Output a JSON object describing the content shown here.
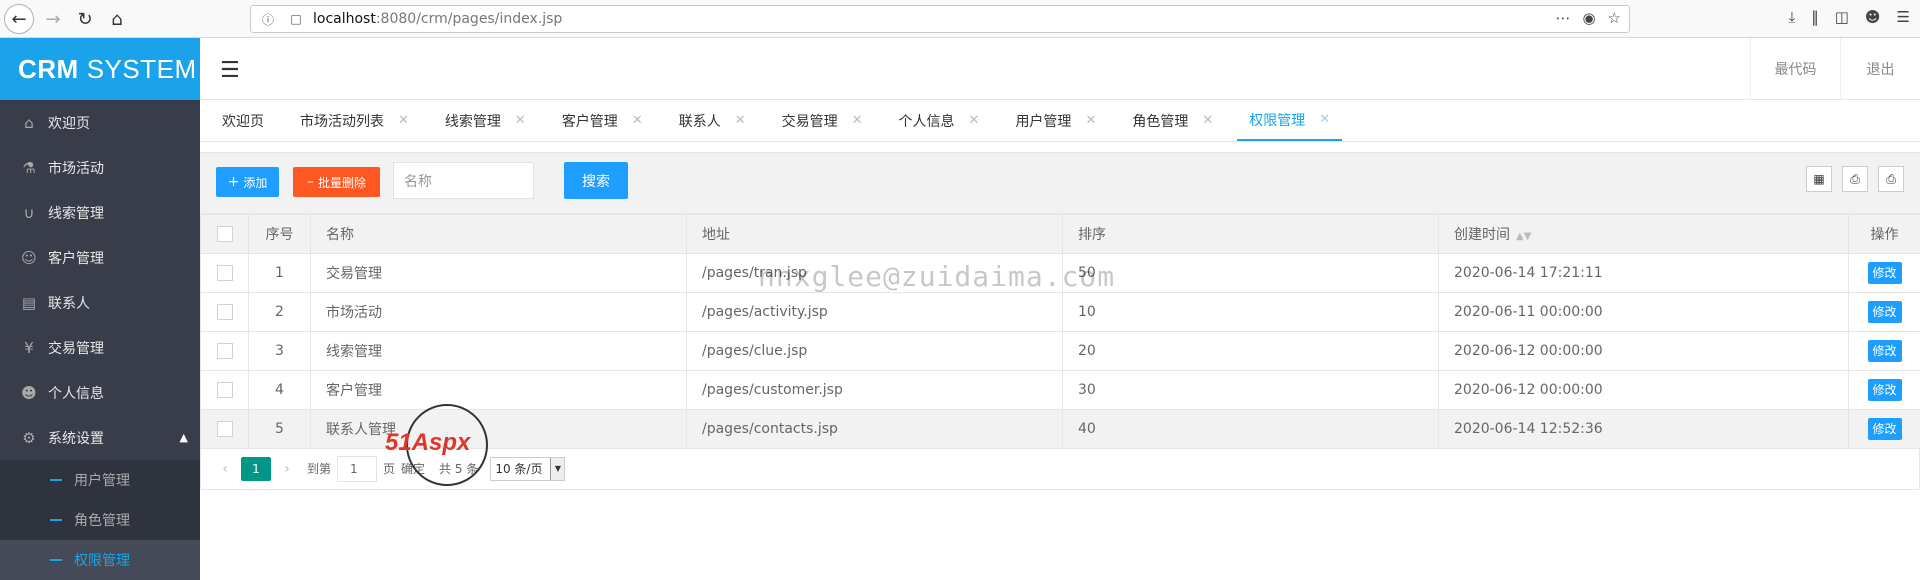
{
  "browser": {
    "url_host": "localhost",
    "url_rest": ":8080/crm/pages/index.jsp",
    "menu_icon": "⋯"
  },
  "sidebar": {
    "logo_bold": "CRM",
    "logo_rest": "SYSTEM",
    "items": [
      {
        "label": "欢迎页",
        "icon": "home-icon"
      },
      {
        "label": "市场活动",
        "icon": "activity-icon"
      },
      {
        "label": "线索管理",
        "icon": "clue-icon"
      },
      {
        "label": "客户管理",
        "icon": "customer-icon"
      },
      {
        "label": "联系人",
        "icon": "contact-icon"
      },
      {
        "label": "交易管理",
        "icon": "trade-icon"
      },
      {
        "label": "个人信息",
        "icon": "user-icon"
      },
      {
        "label": "系统设置",
        "icon": "gear-icon"
      }
    ],
    "sub_items": [
      {
        "label": "用户管理"
      },
      {
        "label": "角色管理"
      },
      {
        "label": "权限管理"
      }
    ]
  },
  "header": {
    "recent_code": "最代码",
    "logout": "退出"
  },
  "tabs": [
    {
      "label": "欢迎页"
    },
    {
      "label": "市场活动列表"
    },
    {
      "label": "线索管理"
    },
    {
      "label": "客户管理"
    },
    {
      "label": "联系人"
    },
    {
      "label": "交易管理"
    },
    {
      "label": "个人信息"
    },
    {
      "label": "用户管理"
    },
    {
      "label": "角色管理"
    },
    {
      "label": "权限管理"
    }
  ],
  "toolbar": {
    "add_label": "添加",
    "batch_delete_label": "批量删除",
    "search_placeholder": "名称",
    "search_label": "搜索"
  },
  "table": {
    "headers": {
      "index": "序号",
      "name": "名称",
      "address": "地址",
      "order": "排序",
      "created": "创建时间",
      "actions": "操作"
    },
    "rows": [
      {
        "index": "1",
        "name": "交易管理",
        "address": "/pages/tran.jsp",
        "order": "50",
        "created": "2020-06-14 17:21:11",
        "action": "修改"
      },
      {
        "index": "2",
        "name": "市场活动",
        "address": "/pages/activity.jsp",
        "order": "10",
        "created": "2020-06-11 00:00:00",
        "action": "修改"
      },
      {
        "index": "3",
        "name": "线索管理",
        "address": "/pages/clue.jsp",
        "order": "20",
        "created": "2020-06-12 00:00:00",
        "action": "修改"
      },
      {
        "index": "4",
        "name": "客户管理",
        "address": "/pages/customer.jsp",
        "order": "30",
        "created": "2020-06-12 00:00:00",
        "action": "修改"
      },
      {
        "index": "5",
        "name": "联系人管理",
        "address": "/pages/contacts.jsp",
        "order": "40",
        "created": "2020-06-14 12:52:36",
        "action": "修改"
      }
    ]
  },
  "pager": {
    "current_page": "1",
    "goto_label": "到第",
    "goto_value": "1",
    "page_unit": "页",
    "ok_label": "确定",
    "total_label": "共 5 条",
    "page_size": "10 条/页"
  },
  "watermark": {
    "text": "nnxglee@zuidaima.com",
    "logo_text": "51Aspx"
  },
  "colors": {
    "sidebar_bg": "#393d49",
    "logo_bg": "#1aa3ea",
    "primary": "#1e9fff",
    "danger": "#ff5722",
    "pager_active": "#009688"
  }
}
